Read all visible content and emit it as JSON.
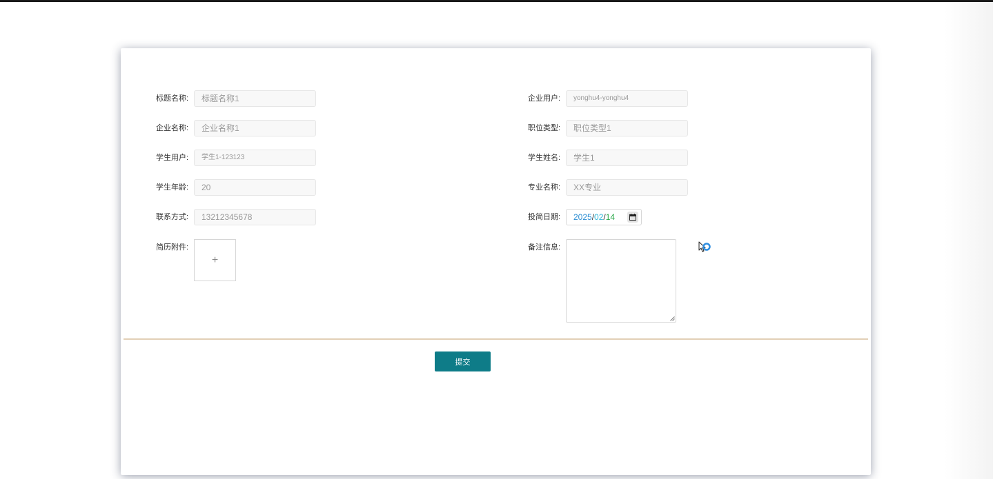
{
  "form": {
    "fields": {
      "title_name": {
        "label": "标题名称:",
        "value": "标题名称1"
      },
      "company_user": {
        "label": "企业用户:",
        "value": "yonghu4-yonghu4"
      },
      "company_name": {
        "label": "企业名称:",
        "value": "企业名称1"
      },
      "job_type": {
        "label": "职位类型:",
        "value": "职位类型1"
      },
      "student_user": {
        "label": "学生用户:",
        "value": "学生1-123123"
      },
      "student_name": {
        "label": "学生姓名:",
        "value": "学生1"
      },
      "student_age": {
        "label": "学生年龄:",
        "value": "20"
      },
      "major_name": {
        "label": "专业名称:",
        "value": "XX专业"
      },
      "contact": {
        "label": "联系方式:",
        "value": "13212345678"
      },
      "submit_date": {
        "label": "投简日期:",
        "year": "2025",
        "sep": "/",
        "month": "02",
        "day": "14",
        "icon": "calendar-icon"
      },
      "resume_attachment": {
        "label": "简历附件:",
        "upload_glyph": "+"
      },
      "remark": {
        "label": "备注信息:",
        "value": ""
      }
    },
    "submit_label": "提交"
  },
  "colors": {
    "submit_button": "#0e7c88",
    "divider": "#e2cfb6",
    "date_year": "#2c8ed3",
    "date_month": "#2fb6d9",
    "date_day": "#2aa84a"
  }
}
